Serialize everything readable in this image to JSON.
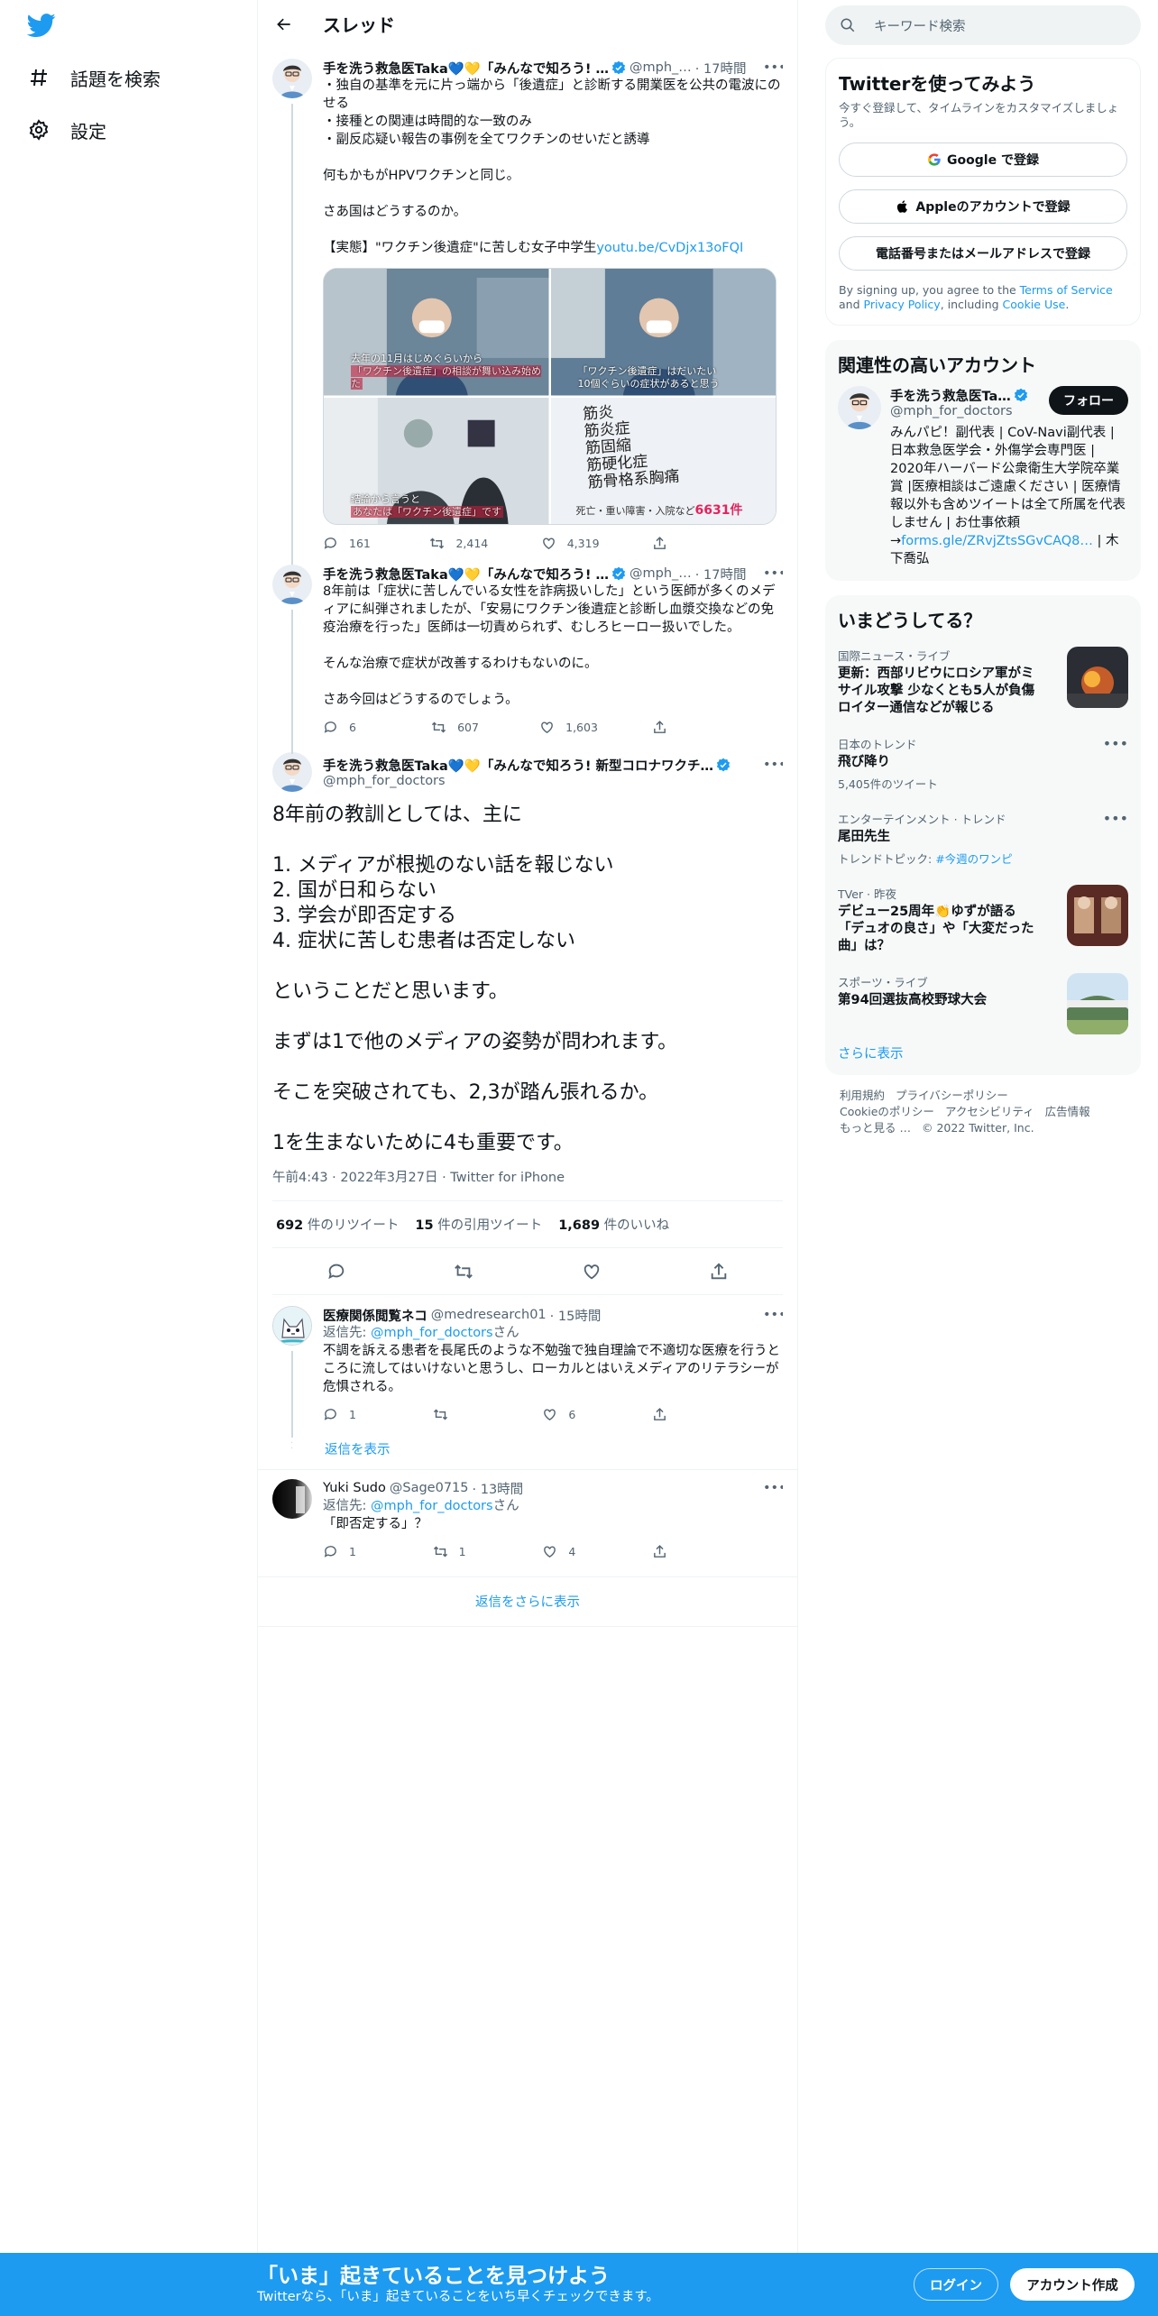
{
  "nav": {
    "explore_label": "話題を検索",
    "settings_label": "設定"
  },
  "header": {
    "title": "スレッド"
  },
  "tweets": [
    {
      "name": "手を洗う救急医Taka💙💛「みんなで知ろう! …",
      "handle": "@mph_…",
      "time": "· 17時間",
      "text": "・独自の基準を元に片っ端から「後遺症」と診断する開業医を公共の電波にのせる\n・接種との関連は時間的な一致のみ\n・副反応疑い報告の事例を全てワクチンのせいだと誘導\n\n何もかもがHPVワクチンと同じ。\n\nさあ国はどうするのか。\n\n【実態】\"ワクチン後遺症\"に苦しむ女子中学生",
      "link": "youtu.be/CvDjx13oFQI",
      "media_captions": {
        "tl_1": "去年の11月はじめぐらいから",
        "tl_2": "「ワクチン後遺症」の相談が舞い込み始めた",
        "tr_1": "「ワクチン後遺症」はだいたい",
        "tr_2": "10個ぐらいの症状があると思う",
        "bl_1": "結論から言うと",
        "bl_2": "あなたは「ワクチン後遺症」です",
        "br_list": "筋炎\n筋炎症\n筋固縮\n筋硬化症\n筋骨格系胸痛",
        "br_foot": "死亡・重い障害・入院など",
        "br_num": "6631件"
      },
      "replies": "161",
      "retweets": "2,414",
      "likes": "4,319"
    },
    {
      "name": "手を洗う救急医Taka💙💛「みんなで知ろう! …",
      "handle": "@mph_…",
      "time": "· 17時間",
      "text": "8年前は「症状に苦しんでいる女性を詐病扱いした」という医師が多くのメディアに糾弾されましたが、「安易にワクチン後遺症と診断し血漿交換などの免疫治療を行った」医師は一切責められず、むしろヒーロー扱いでした。\n\nそんな治療で症状が改善するわけもないのに。\n\nさあ今回はどうするのでしょう。",
      "replies": "6",
      "retweets": "607",
      "likes": "1,603"
    }
  ],
  "focus": {
    "name": "手を洗う救急医Taka💙💛「みんなで知ろう! 新型コロナワクチ…",
    "handle": "@mph_for_doctors",
    "text": "8年前の教訓としては、主に\n\n1. メディアが根拠のない話を報じない\n2. 国が日和らない\n3. 学会が即否定する\n4. 症状に苦しむ患者は否定しない\n\nということだと思います。\n\nまずは1で他のメディアの姿勢が問われます。\n\nそこを突破されても、2,3が踏ん張れるか。\n\n1を生まないために4も重要です。",
    "meta": "午前4:43 · 2022年3月27日 · Twitter for iPhone",
    "retweets_num": "692",
    "retweets_label": "件のリツイート",
    "quotes_num": "15",
    "quotes_label": "件の引用ツイート",
    "likes_num": "1,689",
    "likes_label": "件のいいね"
  },
  "replies": [
    {
      "name": "医療関係閲覧ネコ",
      "handle": "@medresearch01",
      "time": "· 15時間",
      "replying_prefix": "返信先: ",
      "replying_to": "@mph_for_doctors",
      "replying_suffix": "さん",
      "text": "不調を訴える患者を長尾氏のような不勉強で独自理論で不適切な医療を行うところに流してはいけないと思うし、ローカルとはいえメディアのリテラシーが危惧される。",
      "replies": "1",
      "retweets": "",
      "likes": "6",
      "show_replies": "返信を表示"
    },
    {
      "name": "Yuki Sudo",
      "handle": "@Sage0715",
      "time": "· 13時間",
      "replying_prefix": "返信先: ",
      "replying_to": "@mph_for_doctors",
      "replying_suffix": "さん",
      "text": "「即否定する」？",
      "replies": "1",
      "retweets": "1",
      "likes": "4"
    }
  ],
  "more_replies": "返信をさらに表示",
  "right": {
    "search_placeholder": "キーワード検索",
    "signup": {
      "title": "Twitterを使ってみよう",
      "sub": "今すぐ登録して、タイムラインをカスタマイズしましょう。",
      "google": "Google で登録",
      "apple": "Appleのアカウントで登録",
      "phone": "電話番号またはメールアドレスで登録",
      "terms_1": "By signing up, you agree to the ",
      "terms_tos": "Terms of Service",
      "terms_2": " and ",
      "terms_pp": "Privacy Policy",
      "terms_3": ", including ",
      "terms_cookie": "Cookie Use",
      "terms_4": "."
    },
    "relevant": {
      "title": "関連性の高いアカウント",
      "name": "手を洗う救急医Ta…",
      "handle": "@mph_for_doctors",
      "follow": "フォロー",
      "bio": "みんパピ！副代表 | CoV-Navi副代表 | 日本救急医学会・外傷学会専門医 | 2020年ハーバード公衆衛生大学院卒業賞 |医療相談はご遠慮ください | 医療情報以外も含めツイートは全て所属を代表しません | お仕事依頼→",
      "bio_link": "forms.gle/ZRvjZtsSGvCAQ8…",
      "bio_end": " | 木下喬弘"
    },
    "trends": {
      "title": "いまどうしてる？",
      "items": [
        {
          "context": "国際ニュース・ライブ",
          "title": "更新：西部リビウにロシア軍がミサイル攻撃 少なくとも5人が負傷 ロイター通信などが報じる",
          "sub": ""
        },
        {
          "context": "日本のトレンド",
          "title": "飛び降り",
          "sub": "5,405件のツイート"
        },
        {
          "context": "エンターテインメント · トレンド",
          "title": "尾田先生",
          "sub_prefix": "トレンドトピック: ",
          "sub_link": "#今週のワンピ"
        },
        {
          "context": "TVer · 昨夜",
          "title": "デビュー25周年👏ゆずが語る「デュオの良さ」や「大変だった曲」は？",
          "sub": ""
        },
        {
          "context": "スポーツ・ライブ",
          "title": "第94回選抜高校野球大会",
          "sub": ""
        }
      ],
      "show_more": "さらに表示"
    },
    "footer": [
      "利用規約",
      "プライバシーポリシー",
      "Cookieのポリシー",
      "アクセシビリティ",
      "広告情報",
      "もっと見る …",
      "© 2022 Twitter, Inc."
    ]
  },
  "bottom": {
    "title": "「いま」起きていることを見つけよう",
    "sub": "Twitterなら、「いま」起きていることをいち早くチェックできます。",
    "login": "ログイン",
    "signup": "アカウント作成"
  }
}
